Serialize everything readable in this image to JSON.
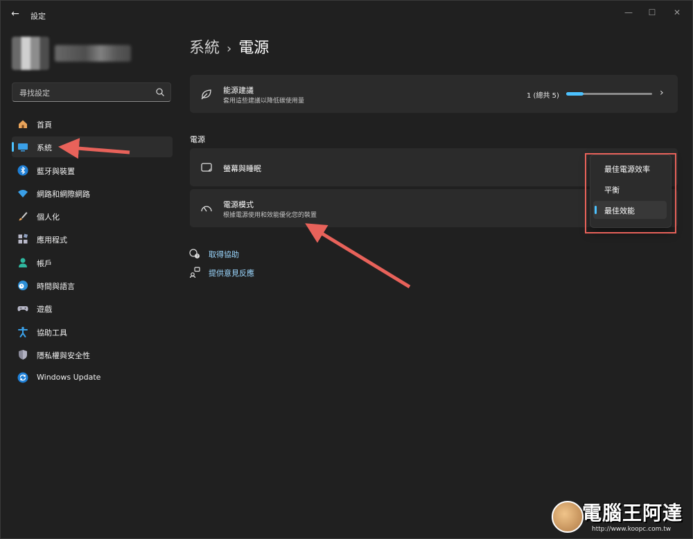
{
  "window": {
    "title": "設定",
    "back_glyph": "←",
    "minimize_glyph": "—",
    "maximize_glyph": "☐",
    "close_glyph": "✕"
  },
  "search": {
    "placeholder": "尋找設定"
  },
  "sidebar": {
    "items": [
      {
        "label": "首頁",
        "icon": "home-icon"
      },
      {
        "label": "系統",
        "icon": "system-icon",
        "active": true
      },
      {
        "label": "藍牙與裝置",
        "icon": "bluetooth-icon"
      },
      {
        "label": "網路和網際網路",
        "icon": "network-icon"
      },
      {
        "label": "個人化",
        "icon": "personalization-icon"
      },
      {
        "label": "應用程式",
        "icon": "apps-icon"
      },
      {
        "label": "帳戶",
        "icon": "account-icon"
      },
      {
        "label": "時間與語言",
        "icon": "time-language-icon"
      },
      {
        "label": "遊戲",
        "icon": "gaming-icon"
      },
      {
        "label": "協助工具",
        "icon": "accessibility-icon"
      },
      {
        "label": "隱私權與安全性",
        "icon": "privacy-icon"
      },
      {
        "label": "Windows Update",
        "icon": "windows-update-icon"
      }
    ]
  },
  "breadcrumb": {
    "parent": "系統",
    "separator": "›",
    "current": "電源"
  },
  "energy_card": {
    "title": "能源建議",
    "subtitle": "套用這些建議以降低碳使用量",
    "count_text": "1 (總共 5)",
    "progress": 0.2,
    "chevron": "›"
  },
  "section": {
    "label": "電源"
  },
  "screen_card": {
    "title": "螢幕與睡眠"
  },
  "power_mode_card": {
    "title": "電源模式",
    "subtitle": "根據電源使用和效能優化您的裝置"
  },
  "power_mode_dropdown": {
    "options": [
      "最佳電源效率",
      "平衡",
      "最佳效能"
    ],
    "selected": "最佳效能"
  },
  "links": {
    "help": "取得協助",
    "feedback": "提供意見反應"
  },
  "watermark": {
    "title": "電腦王阿達",
    "url": "http://www.koopc.com.tw"
  },
  "colors": {
    "accent": "#4cc2ff",
    "annotation": "#e8625a",
    "background": "#202020",
    "card": "#2b2b2b"
  }
}
